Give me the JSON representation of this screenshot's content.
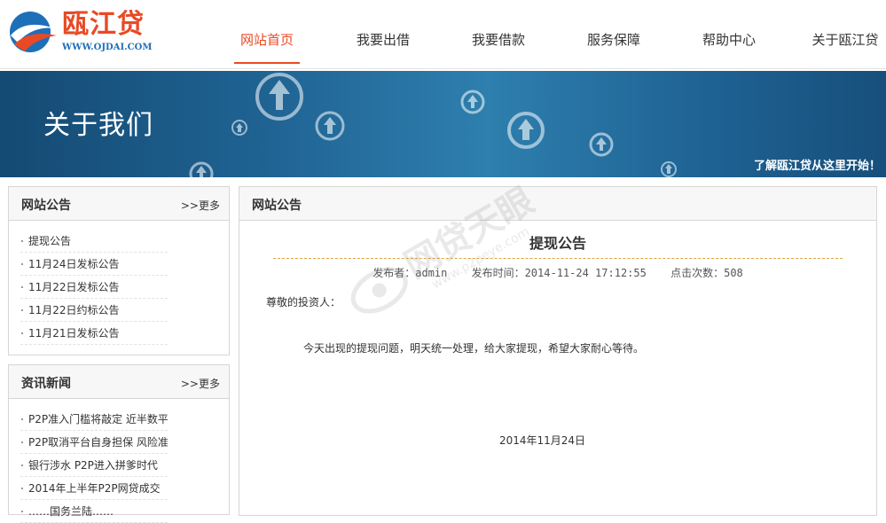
{
  "logo": {
    "name": "瓯江贷",
    "url": "WWW.OJDAI.COM"
  },
  "nav": [
    {
      "label": "网站首页",
      "active": true
    },
    {
      "label": "我要出借",
      "active": false
    },
    {
      "label": "我要借款",
      "active": false
    },
    {
      "label": "服务保障",
      "active": false
    },
    {
      "label": "帮助中心",
      "active": false
    },
    {
      "label": "关于瓯江贷",
      "active": false
    }
  ],
  "banner": {
    "title": "关于我们",
    "slogan": "了解瓯江贷从这里开始！"
  },
  "sidebar": {
    "notices": {
      "title": "网站公告",
      "more": ">>更多",
      "items": [
        "提现公告",
        "11月24日发标公告",
        "11月22日发标公告",
        "11月22日约标公告",
        "11月21日发标公告"
      ]
    },
    "news": {
      "title": "资讯新闻",
      "more": ">>更多",
      "items": [
        "P2P准入门槛将敲定 近半数平",
        "P2P取消平台自身担保 风险准",
        "银行涉水 P2P进入拼爹时代",
        "2014年上半年P2P网贷成交",
        "……国务兰陆……"
      ]
    }
  },
  "main": {
    "section_title": "网站公告",
    "article": {
      "title": "提现公告",
      "publisher_label": "发布者：admin",
      "time_label": "发布时间：2014-11-24 17:12:55",
      "views_label": "点击次数：508",
      "greeting": "尊敬的投资人：",
      "body": "今天出现的提现问题，明天统一处理，给大家提现，希望大家耐心等待。",
      "date": "2014年11月24日"
    }
  },
  "watermark": {
    "text": "网贷天眼",
    "url": "www.p2peye.com"
  },
  "colors": {
    "accent": "#e94a25",
    "brand_blue": "#1d6fb8",
    "banner": "#1f6393"
  }
}
